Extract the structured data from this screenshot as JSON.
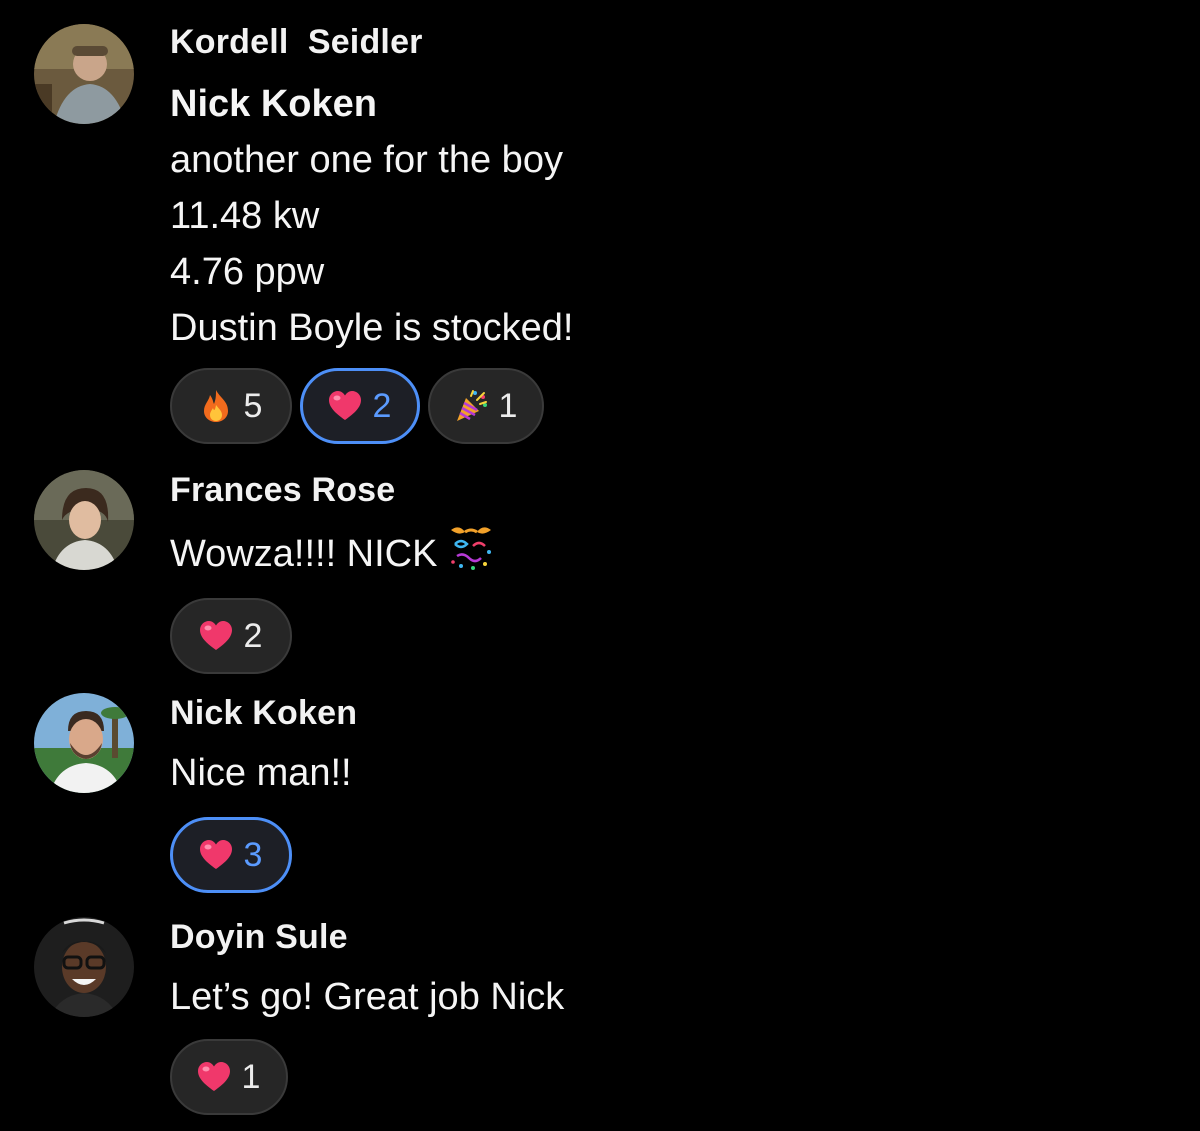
{
  "messages": [
    {
      "sender": "Kordell  Seidler",
      "lines": [
        "Nick Koken",
        "another one for the boy",
        "11.48 kw",
        "4.76 ppw",
        "Dustin Boyle is stocked!"
      ],
      "reactions": [
        {
          "icon": "fire-icon",
          "count": "5",
          "selected": false
        },
        {
          "icon": "heart-icon",
          "count": "2",
          "selected": true
        },
        {
          "icon": "party-popper-icon",
          "count": "1",
          "selected": false
        }
      ]
    },
    {
      "sender": "Frances Rose",
      "lines": [
        "Wowza!!!! NICK"
      ],
      "inline_icon": "confetti-ball-icon",
      "reactions": [
        {
          "icon": "heart-icon",
          "count": "2",
          "selected": false
        }
      ]
    },
    {
      "sender": "Nick Koken",
      "lines": [
        "Nice man!!"
      ],
      "reactions": [
        {
          "icon": "heart-icon",
          "count": "3",
          "selected": true
        }
      ]
    },
    {
      "sender": "Doyin Sule",
      "lines": [
        "Let’s go! Great job Nick"
      ],
      "reactions": [
        {
          "icon": "heart-icon",
          "count": "1",
          "selected": false
        }
      ]
    }
  ],
  "colors": {
    "background": "#000000",
    "pill": "#262626",
    "selected_border": "#4d8ff7",
    "heart": "#f0386b"
  }
}
